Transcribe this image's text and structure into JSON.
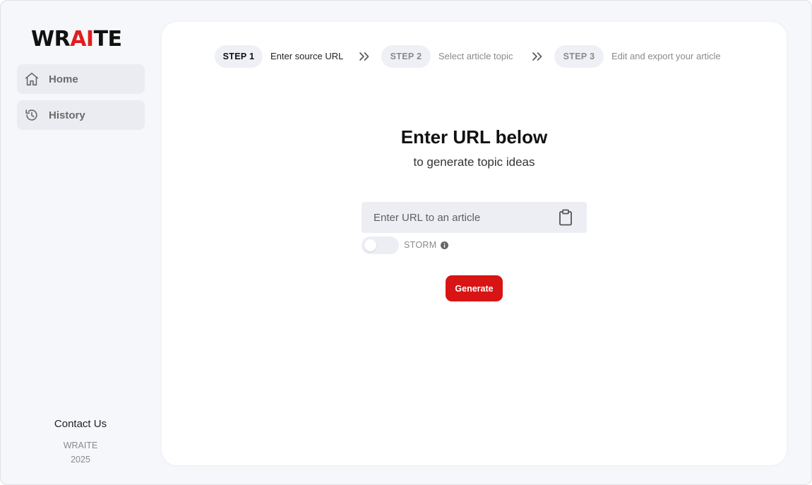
{
  "app": {
    "logo_prefix": "WR",
    "logo_highlight": "AI",
    "logo_suffix": "TE",
    "accent_color": "#d91414"
  },
  "sidebar": {
    "items": [
      {
        "label": "Home",
        "icon": "home-icon"
      },
      {
        "label": "History",
        "icon": "history-icon"
      }
    ],
    "contact": "Contact Us",
    "footer_brand": "WRAITE",
    "footer_year": "2025"
  },
  "stepper": {
    "steps": [
      {
        "badge": "STEP 1",
        "label": "Enter source URL",
        "active": true
      },
      {
        "badge": "STEP 2",
        "label": "Select article topic",
        "active": false
      },
      {
        "badge": "STEP 3",
        "label": "Edit and export your article",
        "active": false
      }
    ],
    "separator_icon": "double-chevron-right-icon"
  },
  "main": {
    "heading": "Enter URL below",
    "subheading": "to generate topic ideas",
    "url_input": {
      "placeholder": "Enter URL to an article",
      "value": "",
      "paste_icon": "clipboard-icon"
    },
    "storm_toggle": {
      "label": "STORM",
      "on": false,
      "info_icon": "info-icon"
    },
    "generate_label": "Generate"
  }
}
